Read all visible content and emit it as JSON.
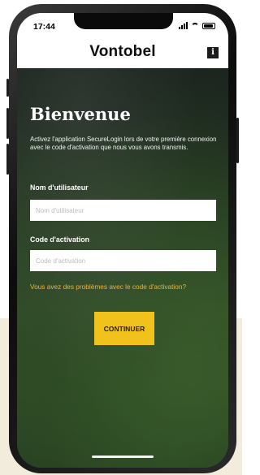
{
  "status_bar": {
    "time": "17:44"
  },
  "header": {
    "title": "Vontobel",
    "info_icon": "info-icon",
    "info_glyph": "i"
  },
  "login": {
    "welcome_title": "Bienvenue",
    "intro_text": "Activez l'application SecureLogin lors de votre première connexion avec le code d'activation que nous vous avons transmis.",
    "username_label": "Nom d'utilisateur",
    "username_placeholder": "Nom d'utilisateur",
    "username_value": "",
    "activation_label": "Code d'activation",
    "activation_placeholder": "Code d'activation",
    "activation_value": "",
    "help_link": "Vous avez des problèmes avec le code d'activation?",
    "continue_button": "CONTINUER"
  },
  "colors": {
    "accent_yellow": "#f2c21c",
    "link_color": "#e8b43a",
    "header_bg": "#ffffff",
    "page_beige": "#f1ecdc"
  },
  "icons": [
    "signal-icon",
    "wifi-icon",
    "battery-icon",
    "info-icon"
  ]
}
